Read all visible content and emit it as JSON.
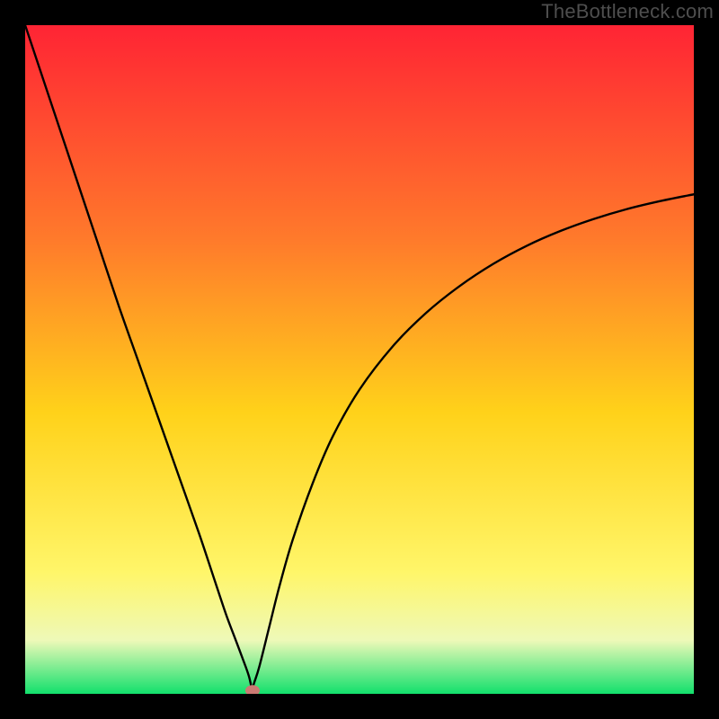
{
  "watermark": "TheBottleneck.com",
  "colors": {
    "frame": "#000000",
    "curve": "#000000",
    "marker": "#cb7a73",
    "gradient_top": "#ff2434",
    "gradient_upper": "#ff7a2b",
    "gradient_mid": "#ffd21a",
    "gradient_lower": "#fff66a",
    "gradient_pale": "#eef9b8",
    "gradient_green": "#12e06c",
    "watermark_text": "#4e4e4e"
  },
  "chart_data": {
    "type": "line",
    "title": "",
    "xlabel": "",
    "ylabel": "",
    "xlim": [
      0,
      100
    ],
    "ylim": [
      0,
      100
    ],
    "x": [
      0,
      2,
      5,
      8,
      11,
      14,
      17,
      20,
      23,
      26,
      28,
      30,
      31.5,
      33,
      33.5,
      33.8,
      34,
      34.2,
      35,
      36.5,
      38,
      40,
      43,
      46,
      50,
      55,
      60,
      65,
      70,
      75,
      80,
      85,
      90,
      95,
      100
    ],
    "values": [
      100,
      94,
      85,
      76,
      67,
      58,
      49.5,
      41,
      32.5,
      24,
      18,
      12,
      8,
      4,
      2.5,
      1.2,
      0.5,
      1.5,
      4,
      10,
      16,
      23,
      31.5,
      38.5,
      45.5,
      52,
      57,
      61,
      64.3,
      67,
      69.2,
      71,
      72.5,
      73.7,
      74.7
    ],
    "marker": {
      "x": 34,
      "y": 0.5
    },
    "background": "vertical-gradient-red-to-green"
  }
}
